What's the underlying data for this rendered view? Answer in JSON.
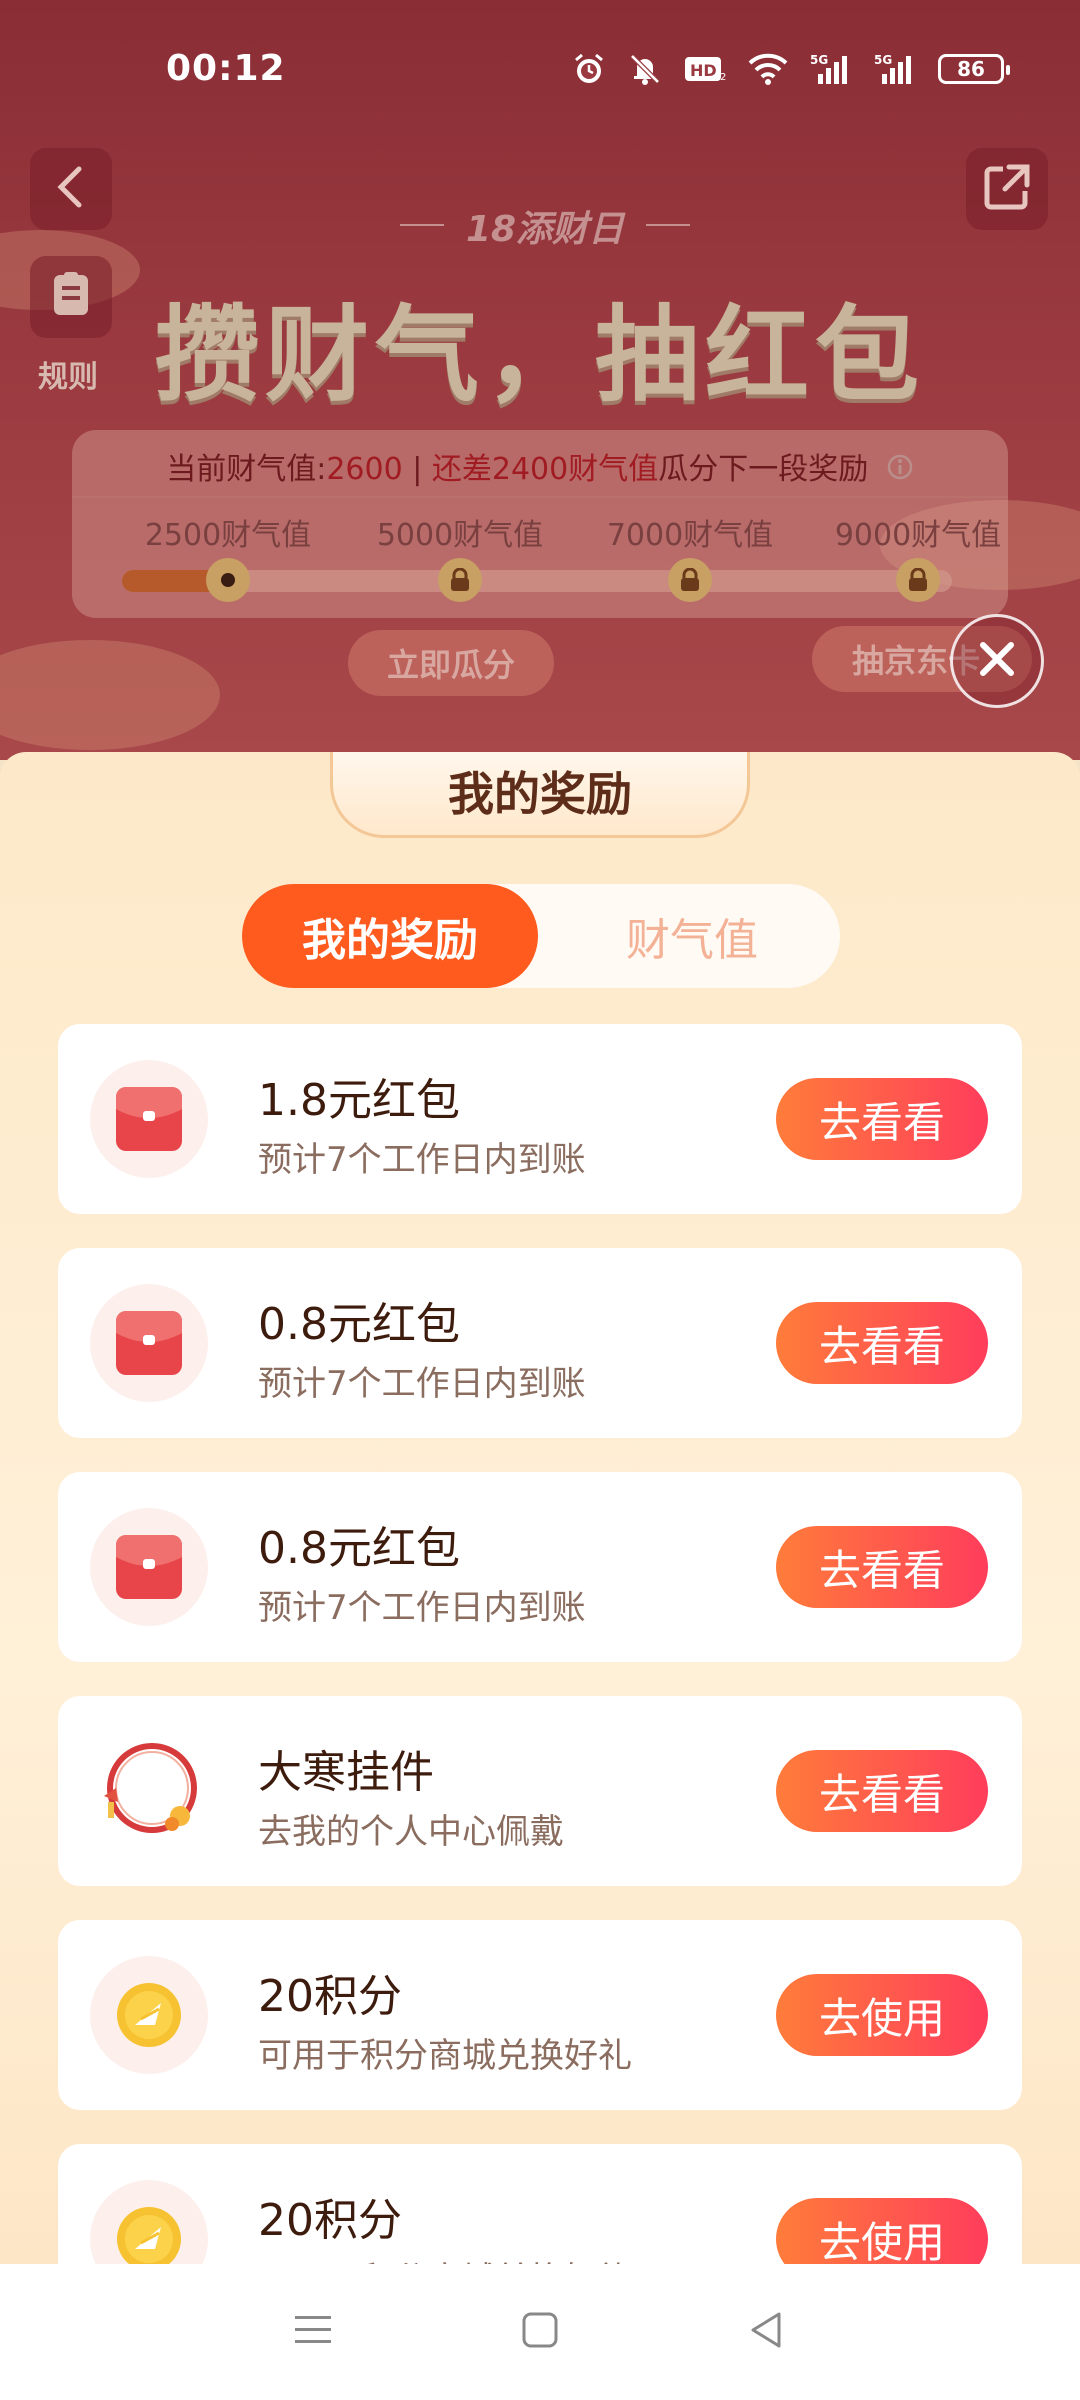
{
  "status_bar": {
    "time": "00:12",
    "battery": "86",
    "icons": [
      "alarm-icon",
      "mute-icon",
      "hd-icon",
      "wifi-icon",
      "signal-5g-icon",
      "signal-5g-icon"
    ]
  },
  "header": {
    "back_icon": "chevron-left-icon",
    "share_icon": "share-icon",
    "rules_icon": "document-icon",
    "rules_label": "规则"
  },
  "event": {
    "subtitle": "18添财日",
    "title": "攒财气，抽红包"
  },
  "progress": {
    "current_prefix": "当前财气值:",
    "current_value": "2600",
    "separator": " | ",
    "remaining_text": "还差2400财气值",
    "remaining_suffix": "瓜分下一段奖励",
    "info_icon": "info-icon",
    "milestones": [
      "2500财气值",
      "5000财气值",
      "7000财气值",
      "9000财气值"
    ],
    "milestone_states": [
      "reached",
      "locked",
      "locked",
      "locked"
    ],
    "fill_fraction": 0.12
  },
  "background_buttons": {
    "claim_label": "立即瓜分",
    "draw_label": "抽京东卡"
  },
  "sheet": {
    "title": "我的奖励",
    "tabs": [
      {
        "label": "我的奖励",
        "active": true
      },
      {
        "label": "财气值",
        "active": false
      }
    ],
    "rewards": [
      {
        "title": "1.8元红包",
        "subtitle": "预计7个工作日内到账",
        "button": "去看看",
        "icon": "red-envelope-icon"
      },
      {
        "title": "0.8元红包",
        "subtitle": "预计7个工作日内到账",
        "button": "去看看",
        "icon": "red-envelope-icon"
      },
      {
        "title": "0.8元红包",
        "subtitle": "预计7个工作日内到账",
        "button": "去看看",
        "icon": "red-envelope-icon"
      },
      {
        "title": "大寒挂件",
        "subtitle": "去我的个人中心佩戴",
        "button": "去看看",
        "icon": "pendant-frame-icon"
      },
      {
        "title": "20积分",
        "subtitle": "可用于积分商城兑换好礼",
        "button": "去使用",
        "icon": "points-coin-icon"
      },
      {
        "title": "20积分",
        "subtitle": "可用于积分商城兑换好礼",
        "button": "去使用",
        "icon": "points-coin-icon"
      }
    ]
  },
  "colors": {
    "accent": "#ff5b1e",
    "button_gradient_start": "#ff7c3a",
    "button_gradient_end": "#ff3d5c",
    "sheet_bg": "#fde9c9",
    "bg_page": "#8a2d35"
  },
  "nav_bar": {
    "menu_icon": "menu-icon",
    "home_icon": "home-square-icon",
    "back_icon": "back-triangle-icon"
  }
}
